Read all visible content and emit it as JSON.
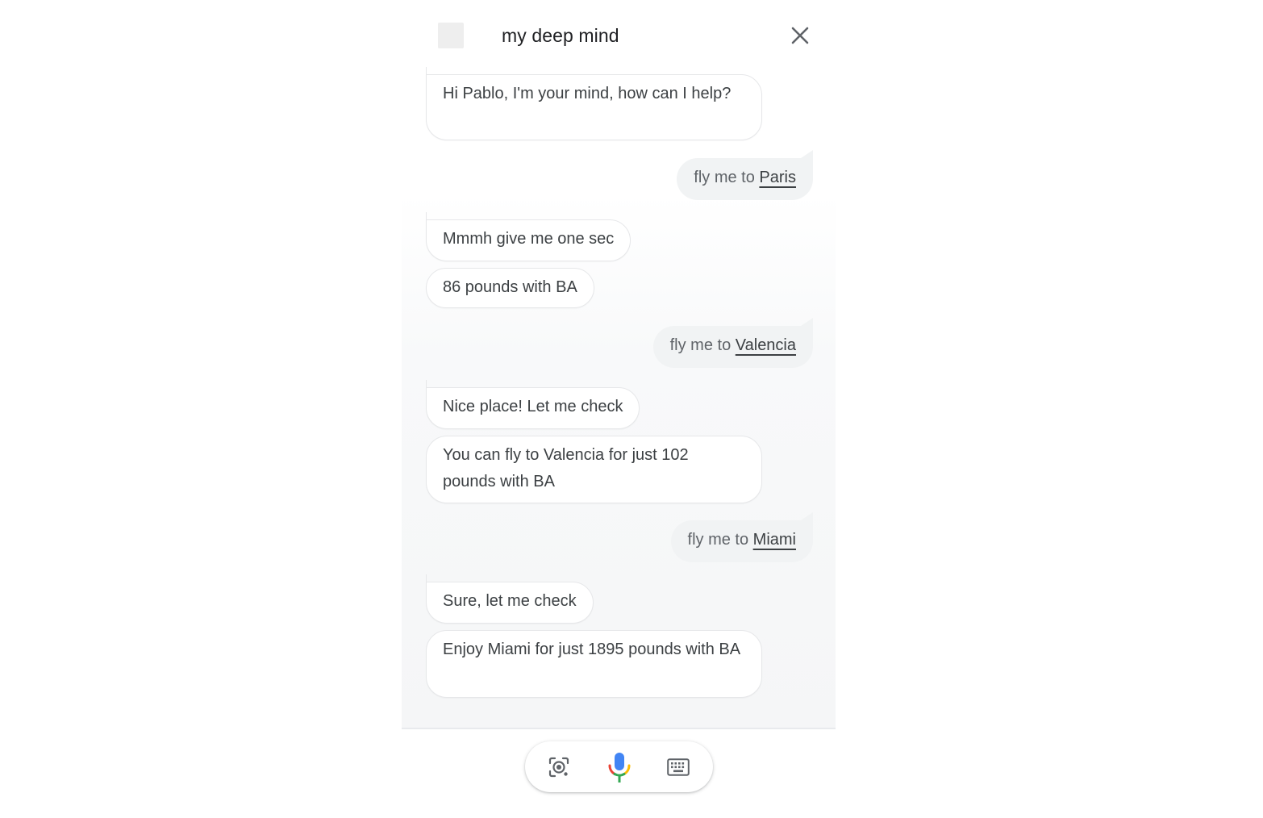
{
  "header": {
    "title": "my deep mind",
    "logo_icon": "app-logo-placeholder",
    "close_icon": "close-icon"
  },
  "messages": [
    {
      "from": "assistant",
      "text": "Hi Pablo, I'm your mind, how can I help?"
    },
    {
      "from": "user",
      "prefix": "fly me to ",
      "destination": "Paris"
    },
    {
      "from": "assistant",
      "text": "Mmmh give me one sec"
    },
    {
      "from": "assistant",
      "text": "86 pounds with BA"
    },
    {
      "from": "user",
      "prefix": "fly me to ",
      "destination": "Valencia"
    },
    {
      "from": "assistant",
      "text": "Nice place! Let me check"
    },
    {
      "from": "assistant",
      "text": "You can fly to Valencia for just 102 pounds with BA"
    },
    {
      "from": "user",
      "prefix": "fly me to ",
      "destination": "Miami"
    },
    {
      "from": "assistant",
      "text": "Sure, let me check"
    },
    {
      "from": "assistant",
      "text": "Enjoy Miami for just 1895 pounds with BA"
    }
  ],
  "input_bar": {
    "icons": [
      "lens-icon",
      "microphone-icon",
      "keyboard-icon"
    ]
  },
  "colors": {
    "user_bubble": "#f1f3f4",
    "assistant_bubble": "#ffffff",
    "text": "#3c4043",
    "mic_blue": "#4285f4",
    "mic_red": "#ea4335",
    "mic_yellow": "#fbbc04",
    "mic_green": "#34a853"
  }
}
